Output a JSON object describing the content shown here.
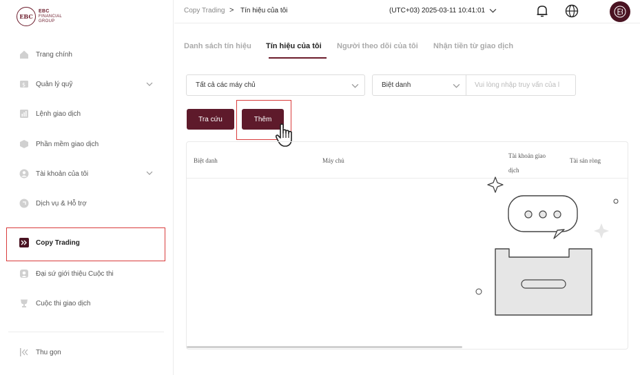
{
  "brand": {
    "logo_mark": "EBC",
    "line1": "EBC",
    "line2": "FINANCIAL",
    "line3": "GROUP",
    "accent_color": "#5e1a2b"
  },
  "sidebar": {
    "items": [
      {
        "label": "Trang chính",
        "icon": "home-icon"
      },
      {
        "label": "Quản lý quỹ",
        "icon": "fund-icon",
        "expandable": true
      },
      {
        "label": "Lệnh giao dịch",
        "icon": "orders-icon"
      },
      {
        "label": "Phần mềm giao dịch",
        "icon": "software-icon"
      },
      {
        "label": "Tài khoản của tôi",
        "icon": "account-icon",
        "expandable": true
      },
      {
        "label": "Dịch vụ & Hỗ trợ",
        "icon": "support-icon"
      },
      {
        "label": "Copy Trading",
        "icon": "copy-trading-icon",
        "active": true
      },
      {
        "label": "Đại sứ giới thiệu Cuộc thi",
        "icon": "ambassador-icon"
      },
      {
        "label": "Cuộc thi giao dịch",
        "icon": "trophy-icon"
      }
    ],
    "collapse_label": "Thu gọn"
  },
  "header": {
    "breadcrumb_root": "Copy Trading",
    "breadcrumb_sep": ">",
    "breadcrumb_current": "Tín hiệu của tôi",
    "timezone_time": "(UTC+03)  2025-03-11 10:41:01"
  },
  "tabs": [
    {
      "label": "Danh sách tín hiệu",
      "active": false
    },
    {
      "label": "Tín hiệu của tôi",
      "active": true
    },
    {
      "label": "Người theo dõi của tôi",
      "active": false
    },
    {
      "label": "Nhận tiền từ giao dịch",
      "active": false
    }
  ],
  "filters": {
    "server_select": "Tất cả các máy chủ",
    "field_select": "Biệt danh",
    "search_placeholder": "Vui lòng nhập truy vấn của l"
  },
  "buttons": {
    "search": "Tra cứu",
    "add": "Thêm"
  },
  "table": {
    "columns": [
      "Biệt danh",
      "Máy chủ",
      "Tài khoản giao dịch",
      "Tài sản ròng"
    ]
  }
}
